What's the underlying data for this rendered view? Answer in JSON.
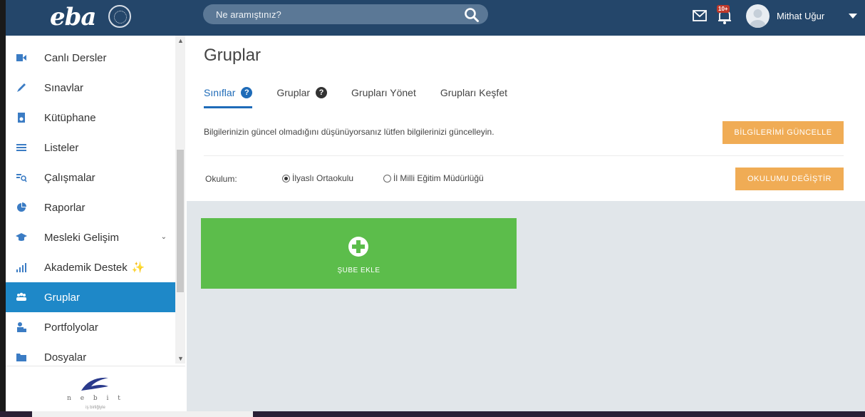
{
  "header": {
    "logo": "eba",
    "search_placeholder": "Ne aramıştınız?",
    "notification_badge": "10+",
    "user_name": "Mithat Uğur"
  },
  "sidebar": {
    "items": [
      {
        "label": "Canlı Dersler",
        "icon": "video-icon"
      },
      {
        "label": "Sınavlar",
        "icon": "pencil-icon"
      },
      {
        "label": "Kütüphane",
        "icon": "library-icon"
      },
      {
        "label": "Listeler",
        "icon": "list-icon"
      },
      {
        "label": "Çalışmalar",
        "icon": "study-icon"
      },
      {
        "label": "Raporlar",
        "icon": "pie-chart-icon"
      },
      {
        "label": "Mesleki Gelişim",
        "icon": "graduation-cap-icon"
      },
      {
        "label": "Akademik Destek",
        "icon": "bar-chart-icon"
      },
      {
        "label": "Gruplar",
        "icon": "users-icon"
      },
      {
        "label": "Portfolyolar",
        "icon": "portfolio-icon"
      },
      {
        "label": "Dosyalar",
        "icon": "folder-icon"
      }
    ],
    "active_index": 8,
    "footer_brand": "n e b i t",
    "footer_sub": "iş birliğiyle"
  },
  "main": {
    "title": "Gruplar",
    "tabs": [
      {
        "label": "Sınıflar",
        "help": true
      },
      {
        "label": "Gruplar",
        "help": true
      },
      {
        "label": "Grupları Yönet",
        "help": false
      },
      {
        "label": "Grupları Keşfet",
        "help": false
      }
    ],
    "active_tab": 0,
    "info_text": "Bilgilerinizin güncel olmadığını düşünüyorsanız lütfen bilgilerinizi güncelleyin.",
    "update_button": "BİLGİLERİMİ GÜNCELLE",
    "school_label": "Okulum:",
    "school_options": [
      "İlyaslı Ortaokulu",
      "İl Milli Eğitim Müdürlüğü"
    ],
    "selected_school": 0,
    "change_school_button": "OKULUMU DEĞİŞTİR",
    "add_card_label": "ŞUBE EKLE"
  },
  "colors": {
    "header_bg": "#24466a",
    "active_item": "#1e88c8",
    "tab_active": "#1e6bb8",
    "orange_button": "#f0ac55",
    "add_card": "#5cbd4b"
  }
}
